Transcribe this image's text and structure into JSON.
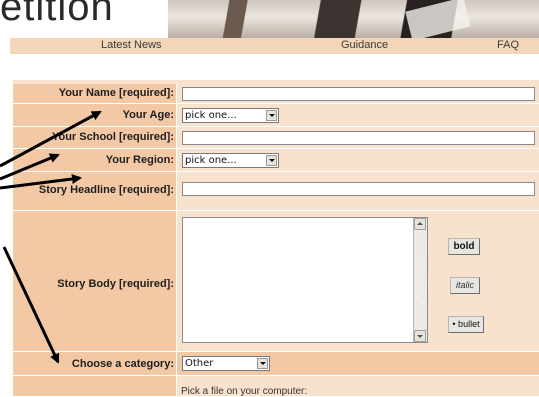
{
  "banner": {
    "title_fragment": "etition"
  },
  "nav": {
    "latest_news": "Latest News",
    "guidance": "Guidance",
    "faq": "FAQ"
  },
  "form": {
    "name_label": "Your Name [required]:",
    "age_label": "Your Age:",
    "age_value": "pick one...",
    "school_label": "Your School [required]:",
    "region_label": "Your Region:",
    "region_value": "pick one...",
    "headline_label": "Story Headline [required]:",
    "body_label": "Story Body [required]:",
    "bold_button": "bold",
    "italic_button": "italic",
    "bullet_button": "• bullet",
    "category_label": "Choose a category:",
    "category_value": "Other",
    "file_note": "Pick a file on your computer:"
  },
  "colors": {
    "label_bg": "#f2c8a5",
    "field_bg": "#f9e2cd",
    "nav_bg": "#f3d5b8",
    "arrow": "#000000"
  },
  "icons": [
    "dropdown-arrow-icon",
    "scroll-up-icon",
    "scroll-down-icon",
    "annotation-arrow"
  ]
}
